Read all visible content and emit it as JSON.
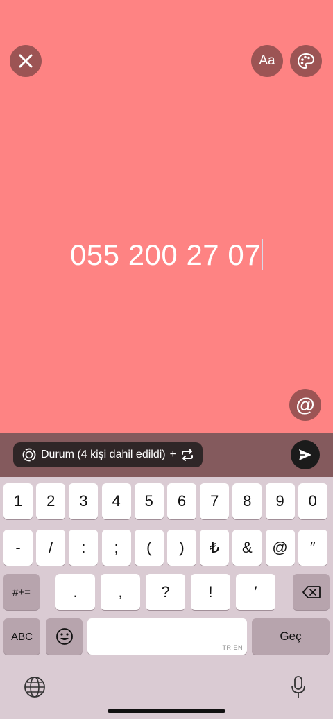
{
  "story_editor": {
    "close_icon": "close-icon",
    "font_button_label": "Aa",
    "palette_icon": "palette-icon",
    "text_content": "055 200 27 07",
    "mention_icon_label": "@",
    "background_color": "#fe8383"
  },
  "audience": {
    "label": "Durum (4 kişi dahil edildi)",
    "plus": "+",
    "status_icon": "status-ring-icon",
    "switch_icon": "repeat-icon",
    "send_icon": "send-icon"
  },
  "keyboard": {
    "row1": [
      "1",
      "2",
      "3",
      "4",
      "5",
      "6",
      "7",
      "8",
      "9",
      "0"
    ],
    "row2": [
      "-",
      "/",
      ":",
      ";",
      "(",
      ")",
      "₺",
      "&",
      "@",
      "″"
    ],
    "row3_toggle": "#+=",
    "row3": [
      ".",
      ",",
      "?",
      "!",
      "′"
    ],
    "backspace_icon": "backspace-icon",
    "abc_label": "ABC",
    "emoji_icon": "emoji-icon",
    "space_lang_tag": "TR EN",
    "return_label": "Geç",
    "globe_icon": "globe-icon",
    "mic_icon": "microphone-icon"
  }
}
